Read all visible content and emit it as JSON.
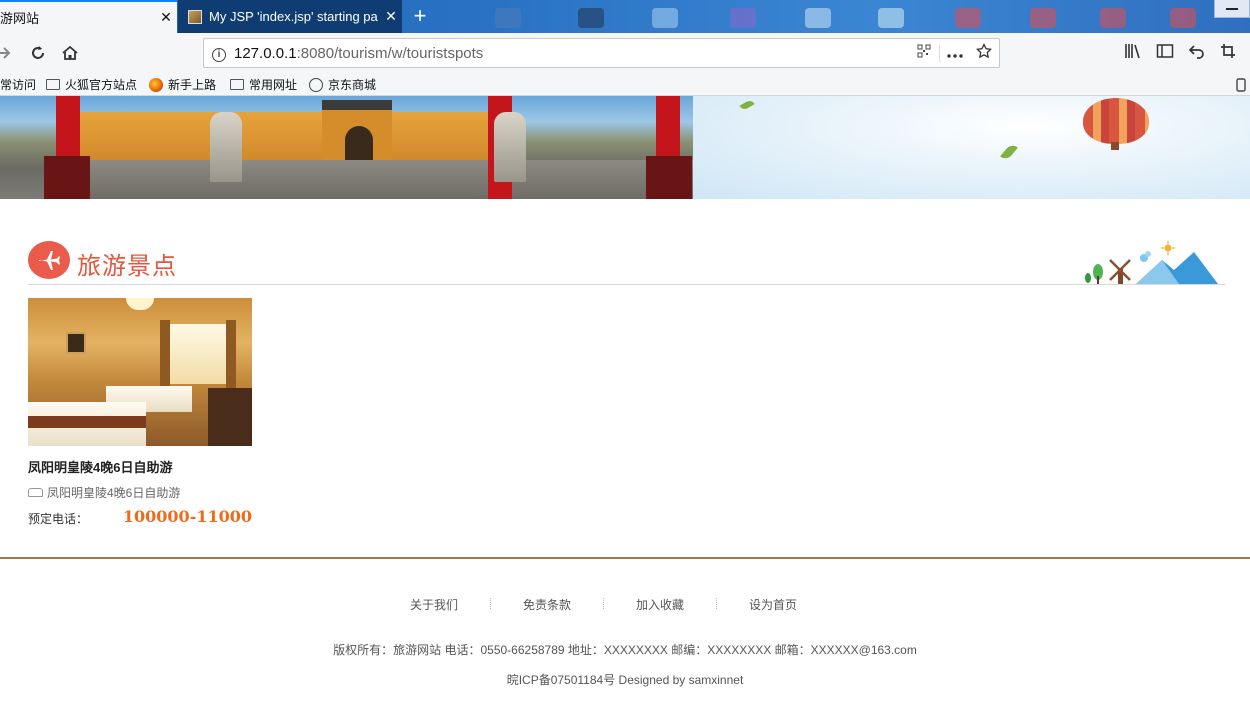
{
  "browser": {
    "tabs": [
      {
        "title": "游网站",
        "close": "✕"
      },
      {
        "title": "My JSP 'index.jsp' starting pa",
        "close": "✕"
      }
    ],
    "new_tab": "+",
    "address": {
      "host": "127.0.0.1",
      "rest": ":8080/tourism/w/touristspots"
    },
    "bookmarks": [
      "常访问",
      "火狐官方站点",
      "新手上路",
      "常用网址",
      "京东商城"
    ]
  },
  "section": {
    "title": "旅游景点"
  },
  "spot": {
    "name": "凤阳明皇陵4晚6日自助游",
    "description": "凤阳明皇陵4晚6日自助游",
    "phone_label": "预定电话：",
    "phone_value": "100000-11000"
  },
  "footer": {
    "links": [
      "关于我们",
      "免责条款",
      "加入收藏",
      "设为首页"
    ],
    "copyright": "版权所有：旅游网站 电话：0550-66258789 地址：XXXXXXXX 邮编：XXXXXXXX 邮箱：XXXXXX@163.com",
    "icp": "晥ICP备07501184号 Designed by samxinnet"
  },
  "colors": {
    "accent": "#e8553f",
    "price": "#f06a1a",
    "footer_rule": "#a9763f"
  }
}
